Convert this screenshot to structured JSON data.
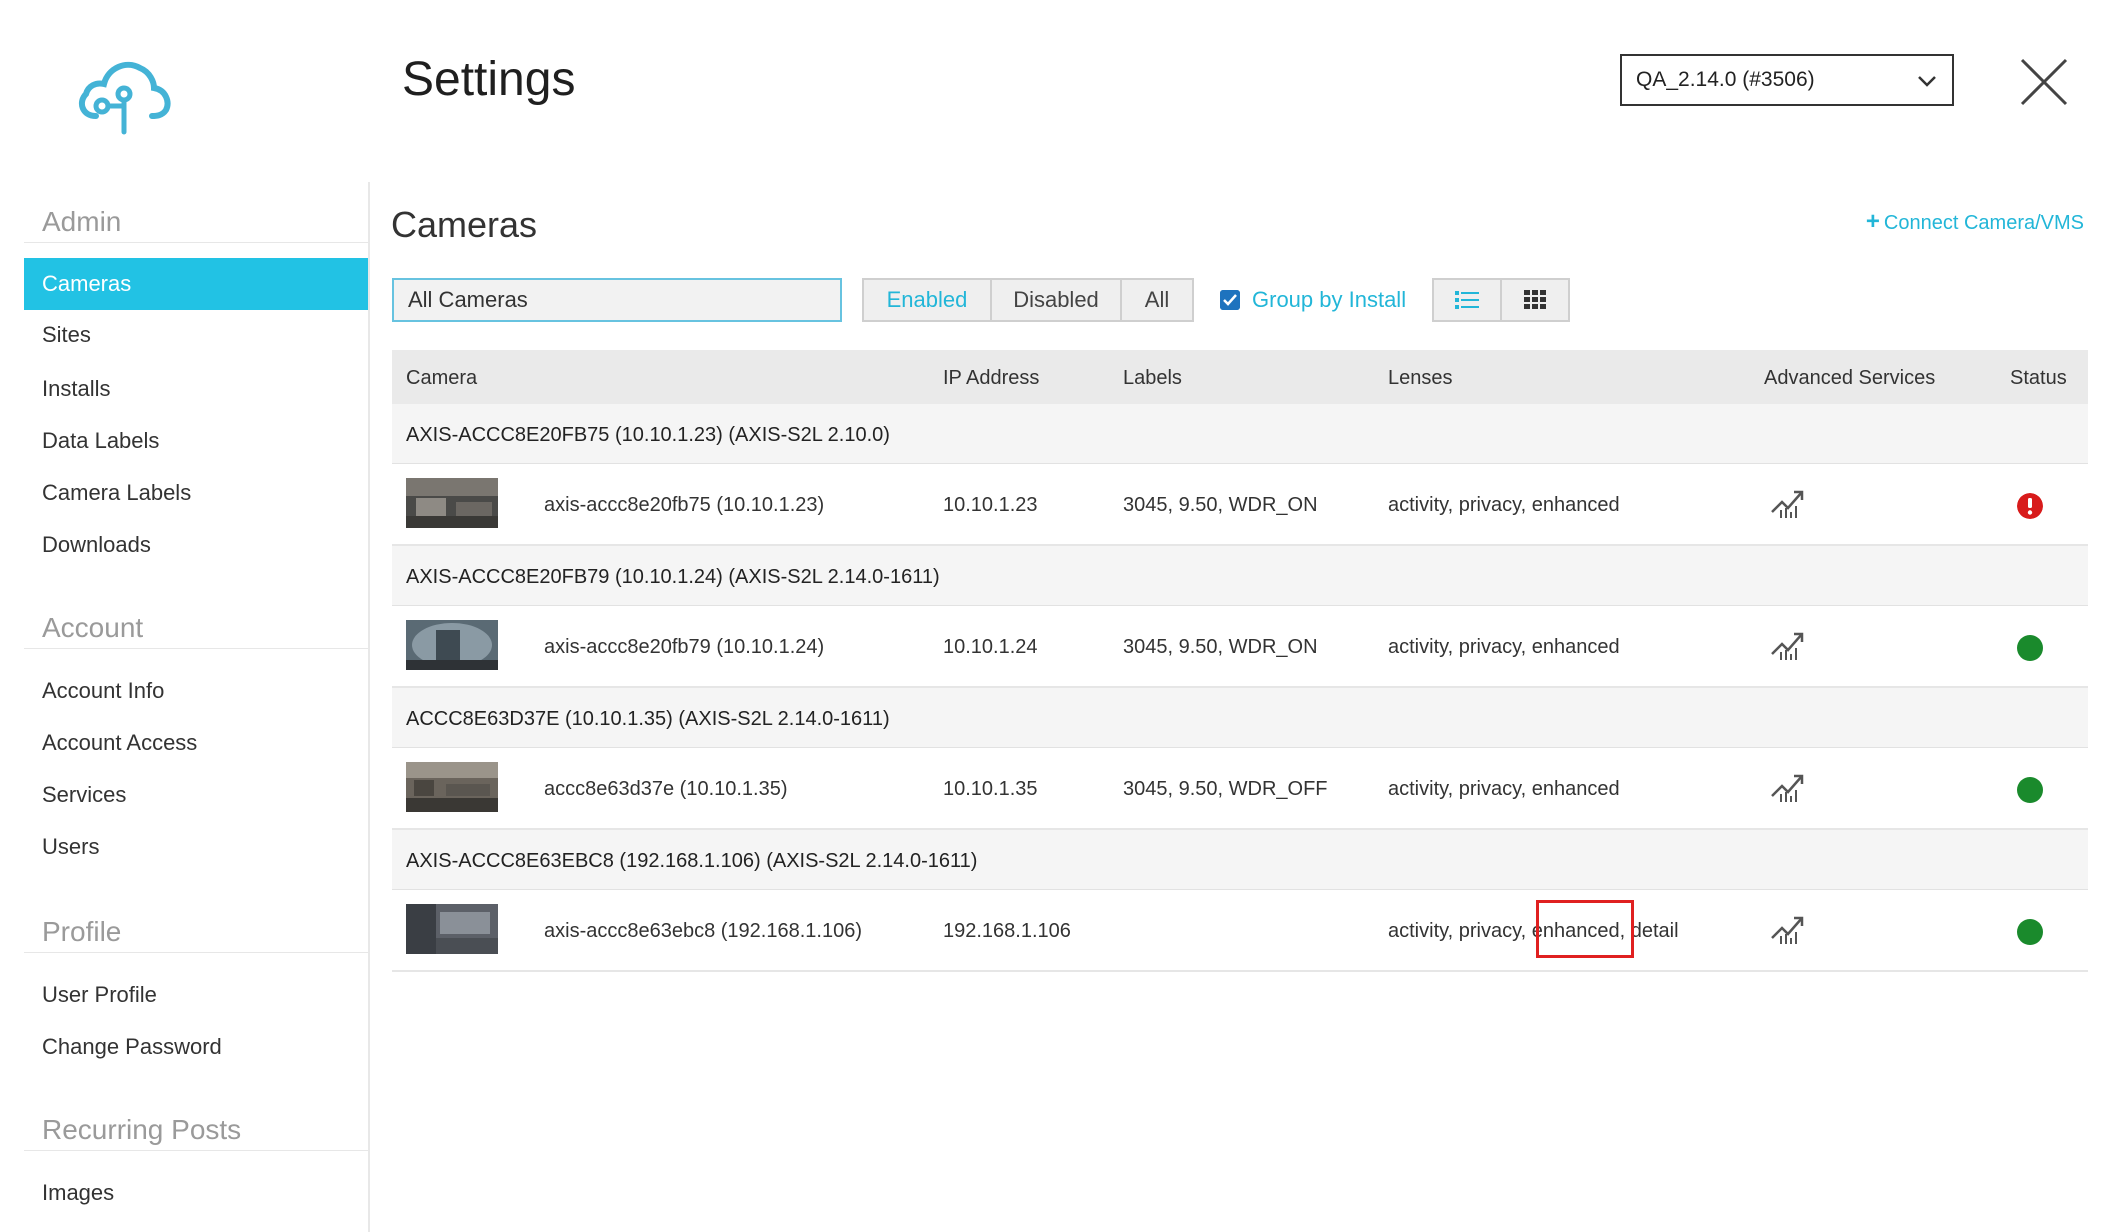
{
  "header": {
    "title": "Settings",
    "version_select": "QA_2.14.0 (#3506)"
  },
  "sidebar": {
    "sections": [
      {
        "heading": "Admin",
        "items": [
          "Cameras",
          "Sites",
          "Installs",
          "Data Labels",
          "Camera Labels",
          "Downloads"
        ]
      },
      {
        "heading": "Account",
        "items": [
          "Account Info",
          "Account Access",
          "Services",
          "Users"
        ]
      },
      {
        "heading": "Profile",
        "items": [
          "User Profile",
          "Change Password"
        ]
      },
      {
        "heading": "Recurring Posts",
        "items": [
          "Images"
        ]
      }
    ],
    "active_item": "Cameras"
  },
  "main": {
    "title": "Cameras",
    "connect_label": "Connect Camera/VMS",
    "filter_value": "All Cameras",
    "segments": [
      "Enabled",
      "Disabled",
      "All"
    ],
    "active_segment": "Enabled",
    "group_by_label": "Group by Install",
    "group_by_checked": true
  },
  "table": {
    "columns": [
      "Camera",
      "IP Address",
      "Labels",
      "Lenses",
      "Advanced Services",
      "Status"
    ],
    "groups": [
      {
        "install": "AXIS-ACCC8E20FB75 (10.10.1.23) (AXIS-S2L 2.10.0)",
        "camera": "axis-accc8e20fb75 (10.10.1.23)",
        "ip": "10.10.1.23",
        "labels": "3045, 9.50, WDR_ON",
        "lenses": "activity, privacy, enhanced",
        "status": "error"
      },
      {
        "install": "AXIS-ACCC8E20FB79 (10.10.1.24) (AXIS-S2L 2.14.0-1611)",
        "camera": "axis-accc8e20fb79 (10.10.1.24)",
        "ip": "10.10.1.24",
        "labels": "3045, 9.50, WDR_ON",
        "lenses": "activity, privacy, enhanced",
        "status": "ok"
      },
      {
        "install": "ACCC8E63D37E (10.10.1.35) (AXIS-S2L 2.14.0-1611)",
        "camera": "accc8e63d37e (10.10.1.35)",
        "ip": "10.10.1.35",
        "labels": "3045, 9.50, WDR_OFF",
        "lenses": "activity, privacy, enhanced",
        "status": "ok"
      },
      {
        "install": "AXIS-ACCC8E63EBC8 (192.168.1.106) (AXIS-S2L 2.14.0-1611)",
        "camera": "axis-accc8e63ebc8 (192.168.1.106)",
        "ip": "192.168.1.106",
        "labels": "",
        "lenses_parts": [
          "activity, privacy, ",
          "enhanced",
          ", detail"
        ],
        "status": "ok"
      }
    ]
  },
  "colors": {
    "accent": "#22c2e4",
    "status_ok": "#1a8a2c",
    "status_error": "#d81b1b",
    "highlight": "#e02020"
  }
}
